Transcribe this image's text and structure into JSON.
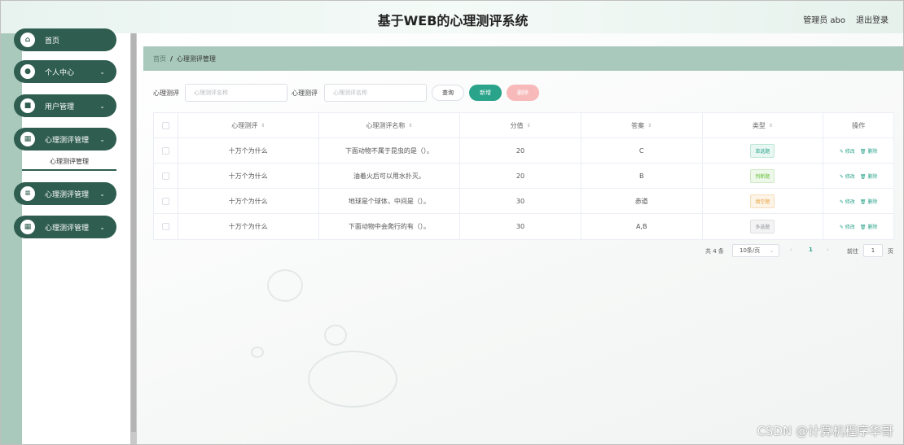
{
  "header": {
    "title": "基于WEB的心理测评系统",
    "user": "管理员 abo",
    "logout": "退出登录"
  },
  "sidebar": {
    "items": [
      {
        "label": "首页",
        "icon": "home-icon",
        "glyph": "⌂",
        "chevron": ""
      },
      {
        "label": "个人中心",
        "icon": "user-icon",
        "glyph": "●",
        "chevron": "⌄"
      },
      {
        "label": "用户管理",
        "icon": "briefcase-icon",
        "glyph": "■",
        "chevron": "⌄"
      },
      {
        "label": "心理测评管理",
        "icon": "grid-icon",
        "glyph": "▦",
        "chevron": "⌄"
      },
      {
        "label": "心理测评管理",
        "icon": "sliders-icon",
        "glyph": "≡",
        "chevron": "⌄"
      },
      {
        "label": "心理测评管理",
        "icon": "grid-icon",
        "glyph": "▦",
        "chevron": "⌄"
      }
    ],
    "submenu": "心理测评管理"
  },
  "breadcrumb": {
    "home": "首页",
    "separator": "/",
    "current": "心理测评管理"
  },
  "search": {
    "label1": "心理测评",
    "placeholder1": "心理测评名称",
    "label2": "心理测评",
    "placeholder2": "心理测评名称",
    "query_btn": "查询",
    "add_btn": "新增",
    "delete_btn": "删除"
  },
  "table": {
    "headers": [
      "心理测评",
      "心理测评名称",
      "分值",
      "答案",
      "类型",
      "操作"
    ],
    "sort_glyph": "⇕",
    "edit_label": "修改",
    "delete_label": "删除",
    "rows": [
      {
        "name": "十万个为什么",
        "question": "下面动物不属于昆虫的是（）。",
        "score": "20",
        "answer": "C",
        "type": "单选题"
      },
      {
        "name": "十万个为什么",
        "question": "油着火后可以用水扑灭。",
        "score": "20",
        "answer": "B",
        "type": "判断题"
      },
      {
        "name": "十万个为什么",
        "question": "地球是个球体，中间是（）。",
        "score": "30",
        "answer": "赤道",
        "type": "填空题"
      },
      {
        "name": "十万个为什么",
        "question": "下面动物中会爬行的有（）。",
        "score": "30",
        "answer": "A,B",
        "type": "多选题"
      }
    ]
  },
  "tag_colors": {
    "单选题": {
      "bg": "#e9f7f2",
      "border": "#bfe6d9",
      "text": "#2aa38b"
    },
    "判断题": {
      "bg": "#eef8ea",
      "border": "#cfe9c4",
      "text": "#67c23a"
    },
    "填空题": {
      "bg": "#fdf4e8",
      "border": "#f6dcb8",
      "text": "#e6a23c"
    },
    "多选题": {
      "bg": "#f4f4f5",
      "border": "#e0e0e3",
      "text": "#909399"
    }
  },
  "pagination": {
    "total": "共 4 条",
    "page_size": "10条/页",
    "current_page": "1",
    "goto_label": "前往",
    "goto_value": "1",
    "page_suffix": "页"
  },
  "watermark": "CSDN @计算机程序华哥"
}
